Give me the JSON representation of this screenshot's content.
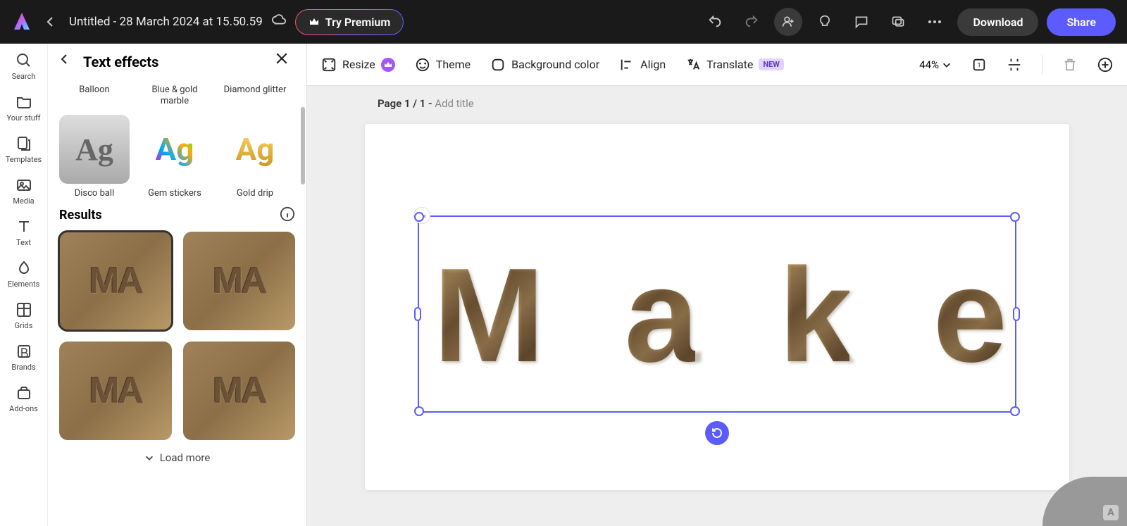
{
  "topbar": {
    "doc_title": "Untitled - 28 March 2024 at 15.50.59",
    "try_premium": "Try Premium",
    "download": "Download",
    "share": "Share"
  },
  "left_rail": [
    {
      "label": "Search",
      "icon": "search"
    },
    {
      "label": "Your stuff",
      "icon": "folder"
    },
    {
      "label": "Templates",
      "icon": "templates"
    },
    {
      "label": "Media",
      "icon": "media"
    },
    {
      "label": "Text",
      "icon": "text"
    },
    {
      "label": "Elements",
      "icon": "elements"
    },
    {
      "label": "Grids",
      "icon": "grids"
    },
    {
      "label": "Brands",
      "icon": "brands"
    },
    {
      "label": "Add-ons",
      "icon": "addons"
    }
  ],
  "side_panel": {
    "title": "Text effects",
    "effects_row1": [
      "Balloon",
      "Blue & gold marble",
      "Diamond glitter"
    ],
    "effects_row2": [
      "Disco ball",
      "Gem stickers",
      "Gold drip"
    ],
    "results_title": "Results",
    "result_count": 4,
    "selected_result_index": 0,
    "load_more": "Load more"
  },
  "toolbar": {
    "resize": "Resize",
    "theme": "Theme",
    "background": "Background color",
    "align": "Align",
    "translate": "Translate",
    "new_badge": "NEW",
    "zoom": "44%"
  },
  "page_info": {
    "prefix": "Page 1 / 1 - ",
    "add_title": "Add title"
  },
  "canvas": {
    "text": "Make"
  }
}
